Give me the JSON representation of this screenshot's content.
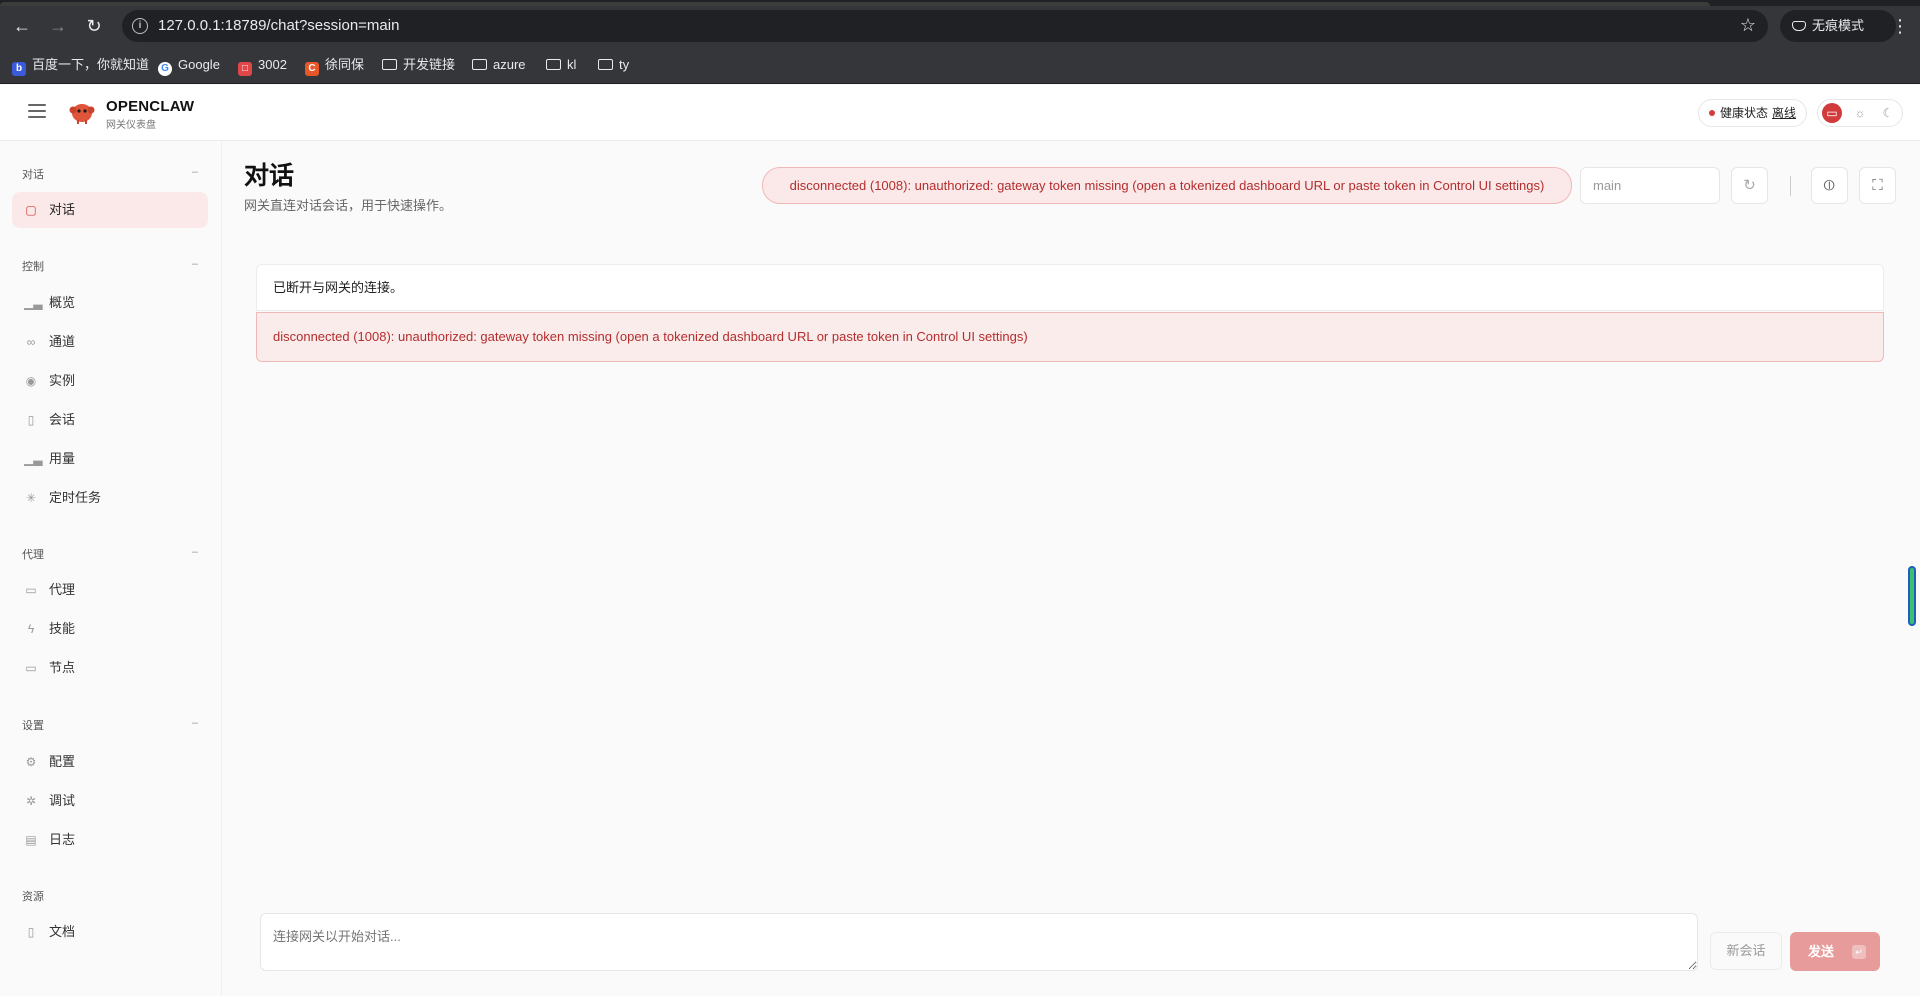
{
  "browser": {
    "url": "127.0.0.1:18789/chat?session=main",
    "incognito_label": "无痕模式",
    "bookmarks": [
      {
        "label": "百度一下，你就知道",
        "icon": "baidu-icon",
        "color": "#3b5bdb"
      },
      {
        "label": "Google",
        "icon": "google-icon",
        "color": "#4285f4"
      },
      {
        "label": "3002",
        "icon": "site-icon",
        "color": "#e04848"
      },
      {
        "label": "徐同保",
        "icon": "csdn-icon",
        "color": "#e8572a"
      },
      {
        "label": "开发链接",
        "icon": "folder-icon"
      },
      {
        "label": "azure",
        "icon": "folder-icon"
      },
      {
        "label": "kl",
        "icon": "folder-icon"
      },
      {
        "label": "ty",
        "icon": "folder-icon"
      }
    ]
  },
  "header": {
    "brand_name": "OPENCLAW",
    "brand_sub": "网关仪表盘",
    "health_label": "健康状态",
    "health_value": "离线",
    "accent": "#d23b3b"
  },
  "sidebar": {
    "sections": [
      {
        "title": "对话",
        "items": [
          {
            "label": "对话",
            "icon": "chat-icon",
            "active": true
          }
        ]
      },
      {
        "title": "控制",
        "items": [
          {
            "label": "概览",
            "icon": "bar-chart-icon"
          },
          {
            "label": "通道",
            "icon": "link-icon"
          },
          {
            "label": "实例",
            "icon": "radio-icon"
          },
          {
            "label": "会话",
            "icon": "document-icon"
          },
          {
            "label": "用量",
            "icon": "bar-chart-icon"
          },
          {
            "label": "定时任务",
            "icon": "loader-icon"
          }
        ]
      },
      {
        "title": "代理",
        "items": [
          {
            "label": "代理",
            "icon": "folder-icon"
          },
          {
            "label": "技能",
            "icon": "bolt-icon"
          },
          {
            "label": "节点",
            "icon": "monitor-icon"
          }
        ]
      },
      {
        "title": "设置",
        "items": [
          {
            "label": "配置",
            "icon": "gear-icon"
          },
          {
            "label": "调试",
            "icon": "bug-icon"
          },
          {
            "label": "日志",
            "icon": "scroll-icon"
          }
        ]
      },
      {
        "title": "资源",
        "items": [
          {
            "label": "文档",
            "icon": "book-icon"
          }
        ]
      }
    ]
  },
  "main": {
    "title": "对话",
    "subtitle": "网关直连对话会话，用于快速操作。",
    "error_pill": "disconnected (1008): unauthorized: gateway token missing (open a tokenized dashboard URL or paste token in Control UI settings)",
    "session_value": "main",
    "notice": "已断开与网关的连接。",
    "error_message": "disconnected (1008): unauthorized: gateway token missing (open a tokenized dashboard URL or paste token in Control UI settings)",
    "composer_placeholder": "连接网关以开始对话...",
    "new_session_label": "新会话",
    "send_label": "发送",
    "send_key": "↵"
  }
}
